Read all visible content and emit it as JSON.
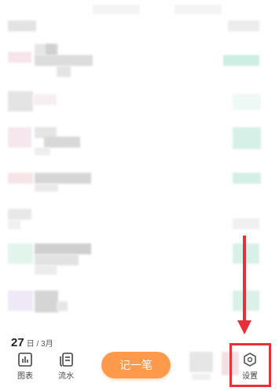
{
  "bottom_nav": {
    "tabs": [
      {
        "label": "图表",
        "icon": "chart-icon"
      },
      {
        "label": "流水",
        "icon": "list-icon"
      },
      {
        "label": "",
        "icon": ""
      },
      {
        "label": "设置",
        "icon": "settings-icon"
      }
    ],
    "record_button": "记一笔"
  },
  "date": {
    "day": "27",
    "month": "日 / 3月"
  },
  "annotation": {
    "color": "#e8303a",
    "target": "settings-tab"
  },
  "accent_color": "#ff9a4d"
}
